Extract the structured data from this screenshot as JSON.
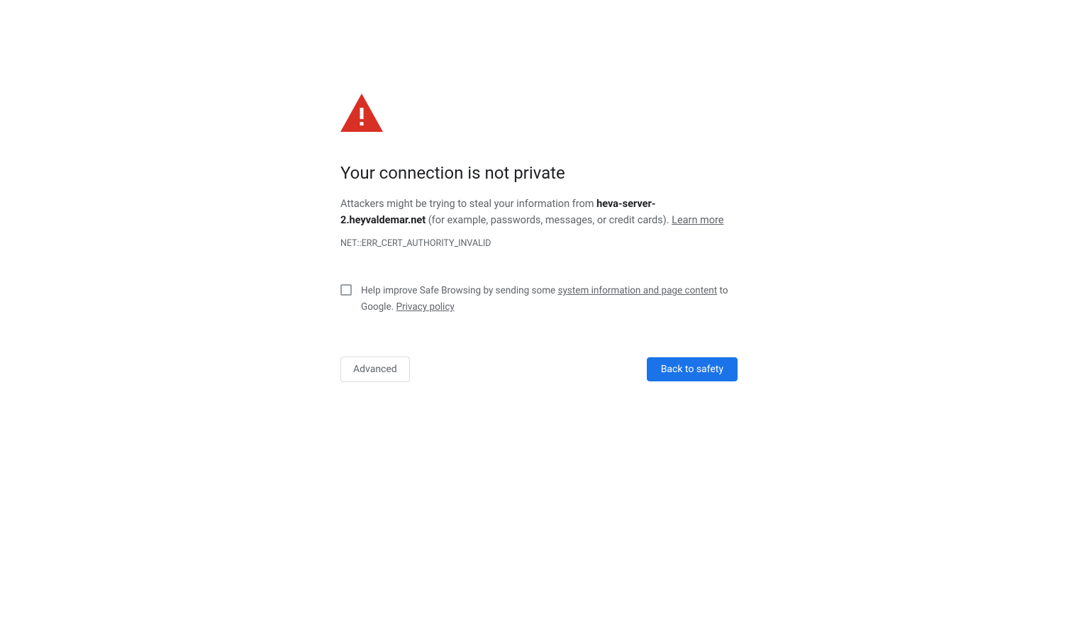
{
  "heading": "Your connection is not private",
  "description": {
    "prefix": "Attackers might be trying to steal your information from ",
    "host": "heva-server-2.heyvaldemar.net",
    "suffix": " (for example, passwords, messages, or credit cards). ",
    "learn_more": "Learn more"
  },
  "error_code": "NET::ERR_CERT_AUTHORITY_INVALID",
  "optin": {
    "prefix": "Help improve Safe Browsing by sending some ",
    "link1": "system information and page content",
    "middle": " to Google. ",
    "link2": "Privacy policy"
  },
  "buttons": {
    "advanced": "Advanced",
    "back": "Back to safety"
  },
  "colors": {
    "warning_red": "#d93025",
    "primary_blue": "#1a73e8"
  }
}
